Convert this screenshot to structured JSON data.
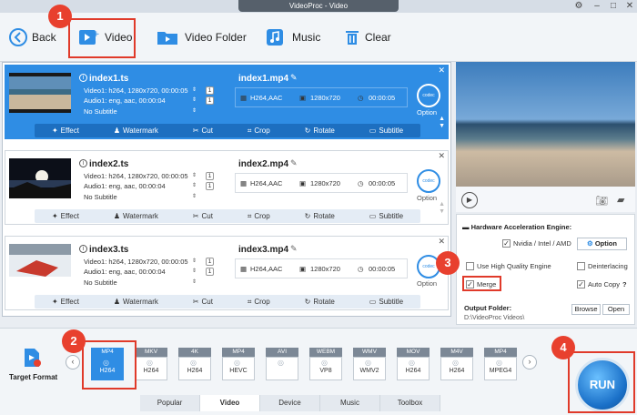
{
  "window": {
    "title": "VideoProc - Video"
  },
  "toolbar": {
    "back": "Back",
    "video": "Video",
    "video_folder": "Video Folder",
    "music": "Music",
    "clear": "Clear"
  },
  "badges": [
    "1",
    "2",
    "3",
    "4"
  ],
  "files": [
    {
      "name": "index1.ts",
      "video": "Video1: h264, 1280x720, 00:00:05",
      "audio": "Audio1: eng, aac, 00:00:04",
      "subtitle": "No Subtitle",
      "video_count": "1",
      "audio_count": "1",
      "output": "index1.mp4",
      "codec": "H264,AAC",
      "resolution": "1280x720",
      "duration": "00:00:05",
      "option_label": "Option"
    },
    {
      "name": "index2.ts",
      "video": "Video1: h264, 1280x720, 00:00:05",
      "audio": "Audio1: eng, aac, 00:00:04",
      "subtitle": "No Subtitle",
      "video_count": "1",
      "audio_count": "1",
      "output": "index2.mp4",
      "codec": "H264,AAC",
      "resolution": "1280x720",
      "duration": "00:00:05",
      "option_label": "Option"
    },
    {
      "name": "index3.ts",
      "video": "Video1: h264, 1280x720, 00:00:05",
      "audio": "Audio1: eng, aac, 00:00:04",
      "subtitle": "No Subtitle",
      "video_count": "1",
      "audio_count": "1",
      "output": "index3.mp4",
      "codec": "H264,AAC",
      "resolution": "1280x720",
      "duration": "00:00:05",
      "option_label": "Option"
    }
  ],
  "card_actions": {
    "effect": "Effect",
    "watermark": "Watermark",
    "cut": "Cut",
    "crop": "Crop",
    "rotate": "Rotate",
    "subtitle": "Subtitle"
  },
  "hardware": {
    "title": "Hardware Acceleration Engine:",
    "nvidia": "Nvidia / Intel / AMD",
    "option_button": "Option",
    "high_quality": "Use High Quality Engine",
    "deinterlacing": "Deinterlacing",
    "merge": "Merge",
    "auto_copy": "Auto Copy",
    "help": "?",
    "output_folder_label": "Output Folder:",
    "output_folder_path": "D:\\VideoProc Videos\\",
    "browse": "Browse",
    "open": "Open"
  },
  "format_bar": {
    "target_format": "Target Format",
    "formats": [
      {
        "top": "MP4",
        "sub": "H264",
        "selected": true
      },
      {
        "top": "MKV",
        "sub": "H264"
      },
      {
        "top": "4K",
        "sub": "H264"
      },
      {
        "top": "MP4",
        "sub": "HEVC"
      },
      {
        "top": "AVI",
        "sub": ""
      },
      {
        "top": "WEBM",
        "sub": "VP8"
      },
      {
        "top": "WMV",
        "sub": "WMV2"
      },
      {
        "top": "MOV",
        "sub": "H264"
      },
      {
        "top": "M4V",
        "sub": "H264"
      },
      {
        "top": "MP4",
        "sub": "MPEG4"
      }
    ],
    "tabs": [
      "Popular",
      "Video",
      "Device",
      "Music",
      "Toolbox"
    ],
    "active_tab": "Video"
  },
  "run_button": "RUN",
  "colors": {
    "accent": "#2f8de4",
    "highlight": "#e03a2a"
  }
}
